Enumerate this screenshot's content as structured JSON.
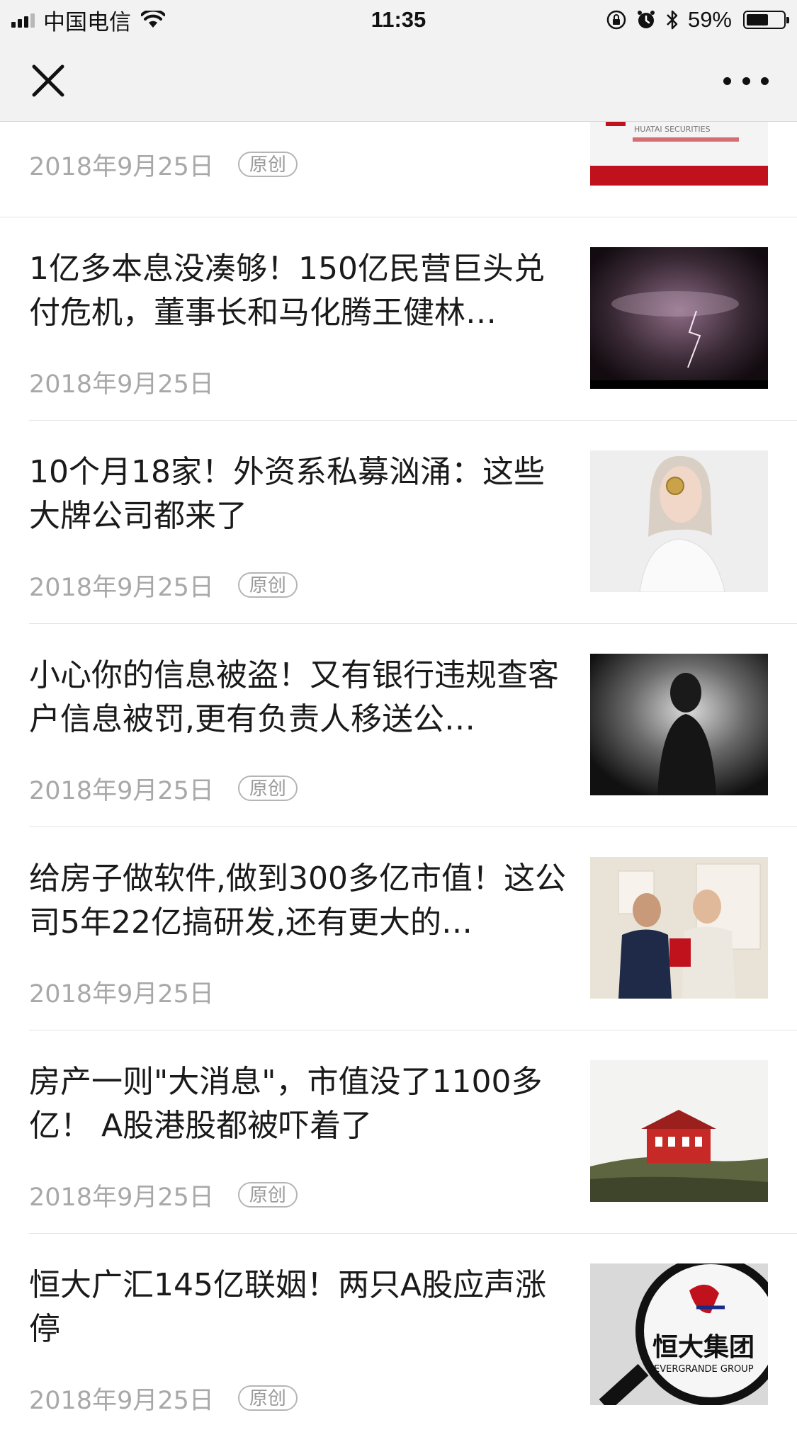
{
  "status_bar": {
    "carrier": "中国电信",
    "time": "11:35",
    "battery_text": "59%",
    "battery_level": 0.59
  },
  "nav": {
    "close_icon": "close-icon",
    "more_icon": "more-icon"
  },
  "badge_label": "原创",
  "partial_item": {
    "date": "2018年9月25日",
    "has_badge": true,
    "logo_text": "HUATAI SECURITIES"
  },
  "articles": [
    {
      "title": "1亿多本息没凑够！150亿民营巨头兑付危机，董事长和马化腾王健林…",
      "date": "2018年9月25日",
      "has_badge": false,
      "thumb": "storm"
    },
    {
      "title": "10个月18家！外资系私募汹涌：这些大牌公司都来了",
      "date": "2018年9月25日",
      "has_badge": true,
      "thumb": "woman-coin"
    },
    {
      "title": "小心你的信息被盗！又有银行违规查客户信息被罚,更有负责人移送公…",
      "date": "2018年9月25日",
      "has_badge": true,
      "thumb": "silhouette"
    },
    {
      "title": "给房子做软件,做到300多亿市值！这公司5年22亿搞研发,还有更大的…",
      "date": "2018年9月25日",
      "has_badge": false,
      "thumb": "two-men"
    },
    {
      "title": "房产一则\"大消息\"，市值没了1100多亿！ A股港股都被吓着了",
      "date": "2018年9月25日",
      "has_badge": true,
      "thumb": "red-house"
    },
    {
      "title": "恒大广汇145亿联姻！两只A股应声涨停",
      "date": "2018年9月25日",
      "has_badge": true,
      "thumb": "evergrande",
      "logo_cn": "恒大集团",
      "logo_en": "EVERGRANDE GROUP"
    }
  ],
  "colors": {
    "bar_bg": "#f2f2f2",
    "date_gray": "#a8a8a8",
    "divider": "#e3e3e3"
  }
}
